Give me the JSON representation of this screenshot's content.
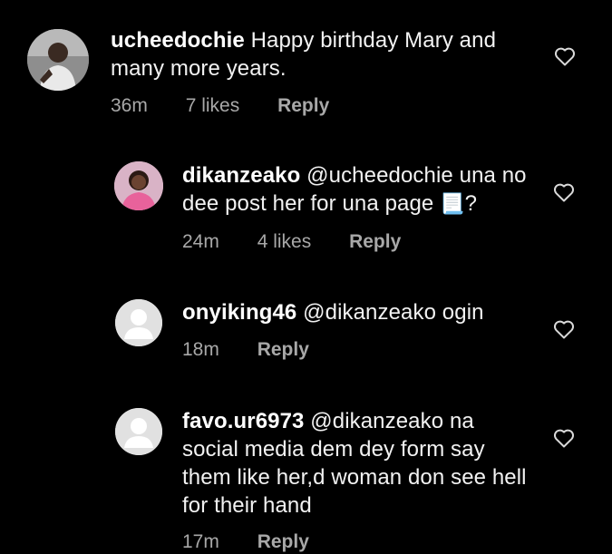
{
  "comments": [
    {
      "username": "ucheedochie",
      "text": "Happy birthday Mary and many more years.",
      "time": "36m",
      "likes": "7 likes",
      "reply": "Reply",
      "avatar": "profile-photo"
    },
    {
      "username": "dikanzeako",
      "text": "@ucheedochie una no dee post her for una page",
      "emoji": "📃",
      "suffix": "?",
      "time": "24m",
      "likes": "4 likes",
      "reply": "Reply",
      "avatar": "profile-photo"
    },
    {
      "username": "onyiking46",
      "text": "@dikanzeako ogin",
      "time": "18m",
      "reply": "Reply",
      "avatar": "default-avatar"
    },
    {
      "username": "favo.ur6973",
      "text": "@dikanzeako na social media dem dey form say them like her,d woman don see hell for their hand",
      "time": "17m",
      "reply": "Reply",
      "avatar": "default-avatar"
    }
  ],
  "colors": {
    "background": "#000000",
    "text": "#f2f2f2",
    "meta": "#a8a8a8",
    "heart_outline": "#d9d9d9"
  },
  "icons": {
    "like": "heart-outline-icon",
    "default_avatar": "person-silhouette-icon",
    "emoji": "page-with-curl-icon"
  }
}
